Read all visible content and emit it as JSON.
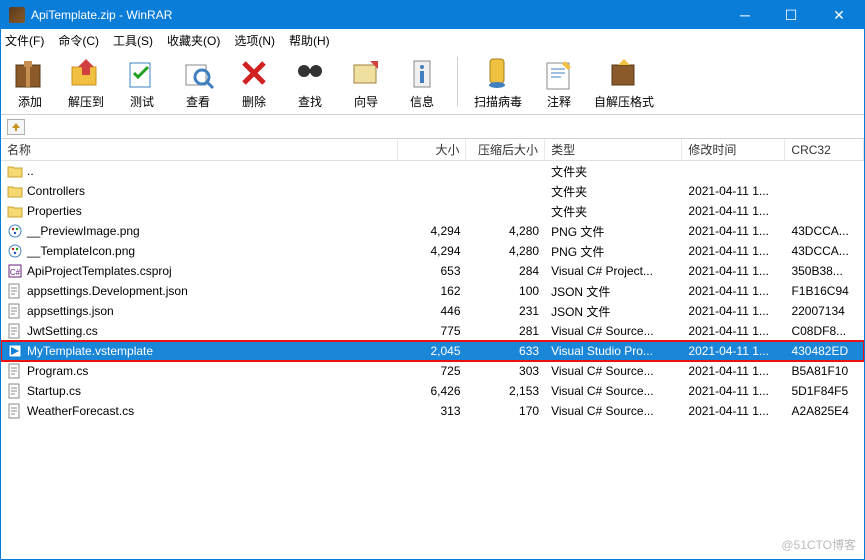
{
  "title": "ApiTemplate.zip - WinRAR",
  "menu": [
    "文件(F)",
    "命令(C)",
    "工具(S)",
    "收藏夹(O)",
    "选项(N)",
    "帮助(H)"
  ],
  "toolbar": {
    "add": "添加",
    "extract": "解压到",
    "test": "测试",
    "view": "查看",
    "delete": "删除",
    "find": "查找",
    "wizard": "向导",
    "info": "信息",
    "scan": "扫描病毒",
    "comment": "注释",
    "sfx": "自解压格式"
  },
  "columns": {
    "name": "名称",
    "size": "大小",
    "csize": "压缩后大小",
    "type": "类型",
    "date": "修改时间",
    "crc": "CRC32"
  },
  "rows": [
    {
      "icon": "folder-up",
      "name": "..",
      "size": "",
      "csize": "",
      "type": "文件夹",
      "date": "",
      "crc": ""
    },
    {
      "icon": "folder",
      "name": "Controllers",
      "size": "",
      "csize": "",
      "type": "文件夹",
      "date": "2021-04-11 1...",
      "crc": ""
    },
    {
      "icon": "folder",
      "name": "Properties",
      "size": "",
      "csize": "",
      "type": "文件夹",
      "date": "2021-04-11 1...",
      "crc": ""
    },
    {
      "icon": "png",
      "name": "__PreviewImage.png",
      "size": "4,294",
      "csize": "4,280",
      "type": "PNG 文件",
      "date": "2021-04-11 1...",
      "crc": "43DCCA..."
    },
    {
      "icon": "png",
      "name": "__TemplateIcon.png",
      "size": "4,294",
      "csize": "4,280",
      "type": "PNG 文件",
      "date": "2021-04-11 1...",
      "crc": "43DCCA..."
    },
    {
      "icon": "csproj",
      "name": "ApiProjectTemplates.csproj",
      "size": "653",
      "csize": "284",
      "type": "Visual C# Project...",
      "date": "2021-04-11 1...",
      "crc": "350B38..."
    },
    {
      "icon": "json",
      "name": "appsettings.Development.json",
      "size": "162",
      "csize": "100",
      "type": "JSON 文件",
      "date": "2021-04-11 1...",
      "crc": "F1B16C94"
    },
    {
      "icon": "json",
      "name": "appsettings.json",
      "size": "446",
      "csize": "231",
      "type": "JSON 文件",
      "date": "2021-04-11 1...",
      "crc": "22007134"
    },
    {
      "icon": "cs",
      "name": "JwtSetting.cs",
      "size": "775",
      "csize": "281",
      "type": "Visual C# Source...",
      "date": "2021-04-11 1...",
      "crc": "C08DF8..."
    },
    {
      "icon": "vst",
      "name": "MyTemplate.vstemplate",
      "size": "2,045",
      "csize": "633",
      "type": "Visual Studio Pro...",
      "date": "2021-04-11 1...",
      "crc": "430482ED",
      "selected": true,
      "highlight": true
    },
    {
      "icon": "cs",
      "name": "Program.cs",
      "size": "725",
      "csize": "303",
      "type": "Visual C# Source...",
      "date": "2021-04-11 1...",
      "crc": "B5A81F10"
    },
    {
      "icon": "cs",
      "name": "Startup.cs",
      "size": "6,426",
      "csize": "2,153",
      "type": "Visual C# Source...",
      "date": "2021-04-11 1...",
      "crc": "5D1F84F5"
    },
    {
      "icon": "cs",
      "name": "WeatherForecast.cs",
      "size": "313",
      "csize": "170",
      "type": "Visual C# Source...",
      "date": "2021-04-11 1...",
      "crc": "A2A825E4"
    }
  ],
  "watermark": "@51CTO博客"
}
